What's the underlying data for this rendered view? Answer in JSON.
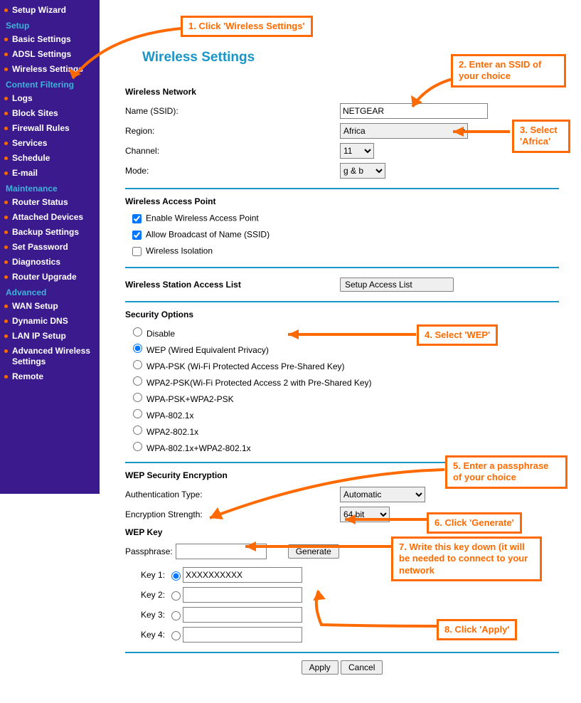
{
  "sidebar": {
    "items": [
      {
        "type": "item",
        "label": "Setup Wizard"
      },
      {
        "type": "group",
        "label": "Setup"
      },
      {
        "type": "item",
        "label": "Basic Settings"
      },
      {
        "type": "item",
        "label": "ADSL Settings"
      },
      {
        "type": "item",
        "label": "Wireless Settings"
      },
      {
        "type": "group",
        "label": "Content Filtering"
      },
      {
        "type": "item",
        "label": "Logs"
      },
      {
        "type": "item",
        "label": "Block Sites"
      },
      {
        "type": "item",
        "label": "Firewall Rules"
      },
      {
        "type": "item",
        "label": "Services"
      },
      {
        "type": "item",
        "label": "Schedule"
      },
      {
        "type": "item",
        "label": "E-mail"
      },
      {
        "type": "group",
        "label": "Maintenance"
      },
      {
        "type": "item",
        "label": "Router Status"
      },
      {
        "type": "item",
        "label": "Attached Devices"
      },
      {
        "type": "item",
        "label": "Backup Settings"
      },
      {
        "type": "item",
        "label": "Set Password"
      },
      {
        "type": "item",
        "label": "Diagnostics"
      },
      {
        "type": "item",
        "label": "Router Upgrade"
      },
      {
        "type": "group",
        "label": "Advanced"
      },
      {
        "type": "item",
        "label": "WAN Setup"
      },
      {
        "type": "item",
        "label": "Dynamic DNS"
      },
      {
        "type": "item",
        "label": "LAN IP Setup"
      },
      {
        "type": "item",
        "label": "Advanced Wireless Settings"
      },
      {
        "type": "item",
        "label": "Remote"
      }
    ]
  },
  "page": {
    "title": "Wireless Settings"
  },
  "network": {
    "heading": "Wireless Network",
    "ssid_label": "Name (SSID):",
    "ssid_value": "NETGEAR",
    "region_label": "Region:",
    "region_value": "Africa",
    "channel_label": "Channel:",
    "channel_value": "11",
    "mode_label": "Mode:",
    "mode_value": "g & b"
  },
  "ap": {
    "heading": "Wireless Access Point",
    "enable": "Enable Wireless Access Point",
    "broadcast": "Allow Broadcast of Name (SSID)",
    "isolation": "Wireless Isolation"
  },
  "acl": {
    "heading": "Wireless Station Access List",
    "button": "Setup Access List"
  },
  "sec": {
    "heading": "Security Options",
    "opts": [
      "Disable",
      "WEP (Wired Equivalent Privacy)",
      "WPA-PSK (Wi-Fi Protected Access Pre-Shared Key)",
      "WPA2-PSK(Wi-Fi Protected Access 2 with Pre-Shared Key)",
      "WPA-PSK+WPA2-PSK",
      "WPA-802.1x",
      "WPA2-802.1x",
      "WPA-802.1x+WPA2-802.1x"
    ],
    "selected": 1
  },
  "wep": {
    "heading": "WEP Security Encryption",
    "auth_label": "Authentication Type:",
    "auth_value": "Automatic",
    "strength_label": "Encryption Strength:",
    "strength_value": "64 bit",
    "key_heading": "WEP Key",
    "pass_label": "Passphrase:",
    "generate": "Generate",
    "keys": [
      "Key 1:",
      "Key 2:",
      "Key 3:",
      "Key 4:"
    ],
    "key1_value": "XXXXXXXXXX"
  },
  "footer": {
    "apply": "Apply",
    "cancel": "Cancel"
  },
  "anno": {
    "c1": "1. Click 'Wireless Settings'",
    "c2": "2. Enter an SSID of your choice",
    "c3": "3. Select 'Africa'",
    "c4": "4. Select 'WEP'",
    "c5": "5. Enter a passphrase of your choice",
    "c6": "6. Click 'Generate'",
    "c7": "7. Write this key down (it will be needed to connect to your network",
    "c8": "8. Click 'Apply'"
  }
}
